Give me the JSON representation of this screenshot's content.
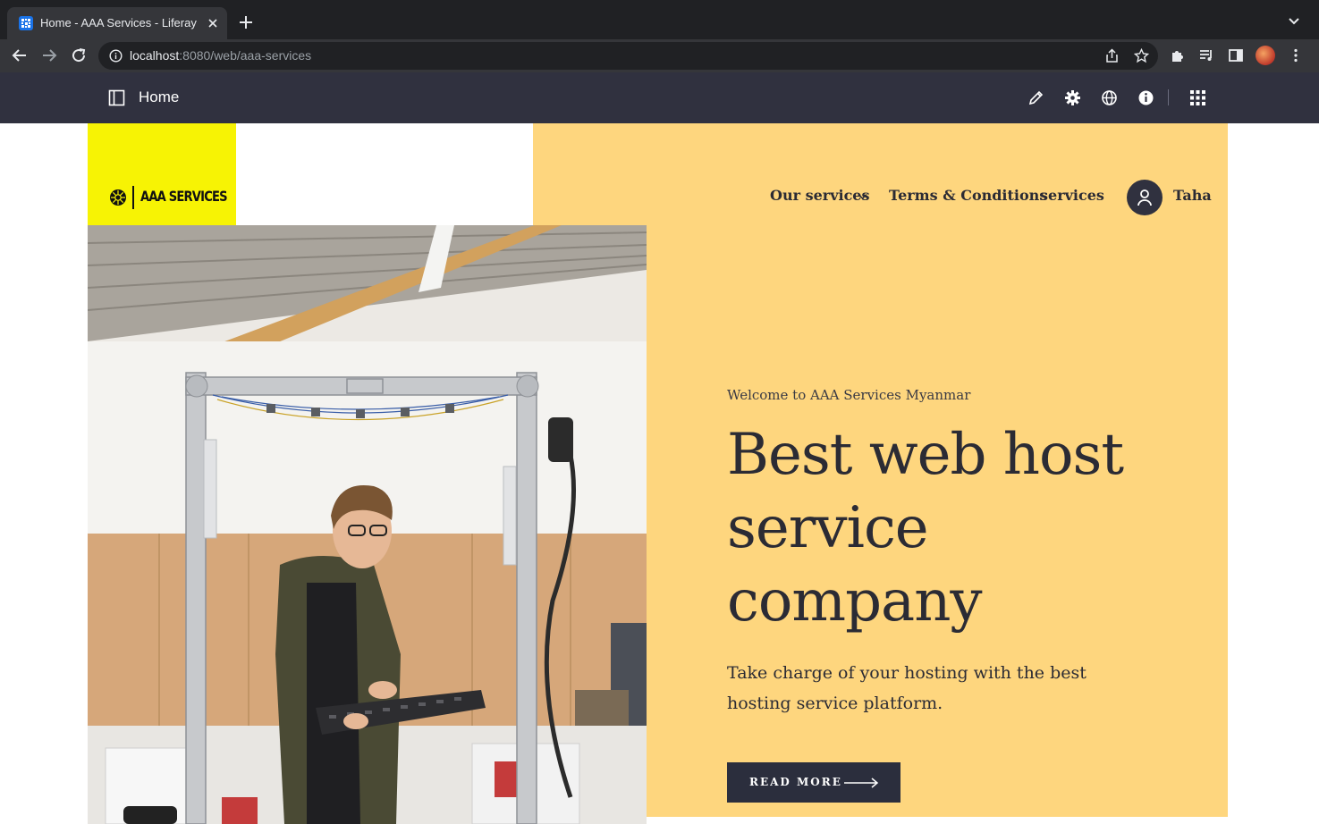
{
  "browser": {
    "tab": {
      "title": "Home - AAA Services - Liferay"
    },
    "address": {
      "host": "localhost",
      "path": ":8080/web/aaa-services"
    }
  },
  "control_menu": {
    "title": "Home"
  },
  "site": {
    "logo_text": "AAA SERVICES",
    "nav": {
      "our_services": "Our services",
      "terms": "Terms & Conditions",
      "services": "services"
    },
    "user": {
      "name": "Taha"
    }
  },
  "hero": {
    "eyebrow": "Welcome to AAA Services Myanmar",
    "headline": "Best web host service company",
    "subtext": "Take charge of your hosting with the best hosting service platform.",
    "cta_label": "READ MORE"
  },
  "colors": {
    "hero_bg": "#fed67e",
    "logo_bg": "#f7f304",
    "control_menu_bg": "#30313f",
    "cta_bg": "#2b2e3d"
  }
}
